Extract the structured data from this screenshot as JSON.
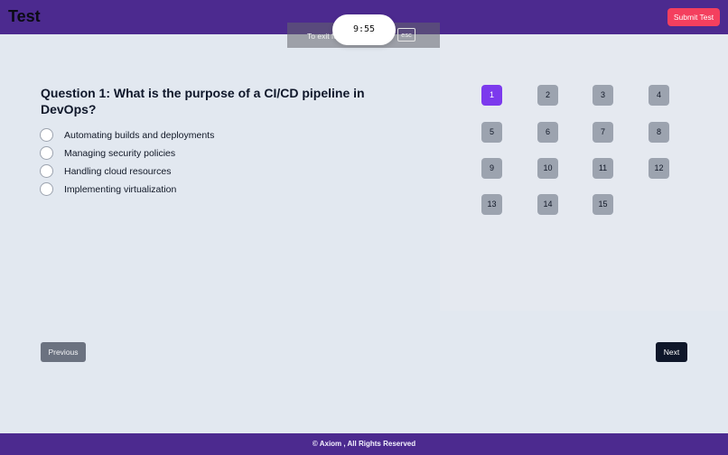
{
  "header": {
    "title": "Test",
    "submit_label": "Submit Test"
  },
  "fullscreen_notice": {
    "text": "To exit full screen, press",
    "key": "esc"
  },
  "timer": {
    "value": "9:55"
  },
  "question": {
    "title": "Question 1: What is the purpose of a CI/CD pipeline in DevOps?",
    "options": [
      "Automating builds and deployments",
      "Managing security policies",
      "Handling cloud resources",
      "Implementing virtualization"
    ]
  },
  "navigator": {
    "items": [
      "1",
      "2",
      "3",
      "4",
      "5",
      "6",
      "7",
      "8",
      "9",
      "10",
      "11",
      "12",
      "13",
      "14",
      "15"
    ],
    "current": "1"
  },
  "controls": {
    "previous_label": "Previous",
    "next_label": "Next"
  },
  "footer": {
    "text": "© Axiom , All Rights Reserved"
  },
  "colors": {
    "header": "#4c2a8f",
    "submit": "#f43f5e",
    "active_question": "#7c3aed",
    "question_button": "#9ca3af",
    "next_button": "#0f172a"
  }
}
